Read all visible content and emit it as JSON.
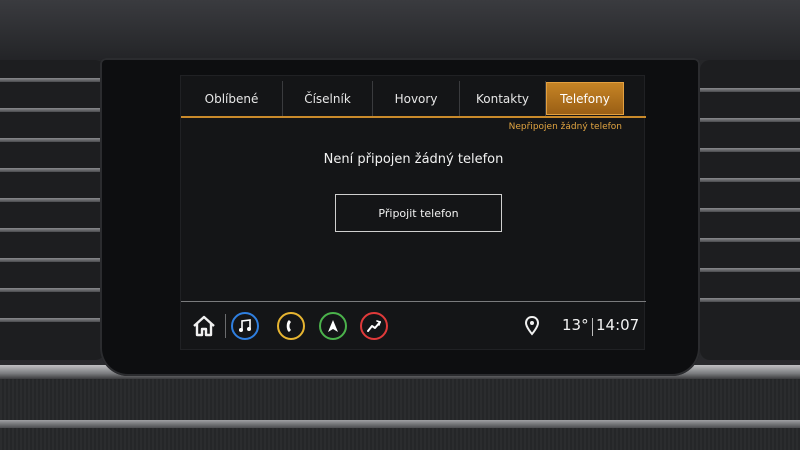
{
  "tabs": [
    {
      "label": "Oblíbené",
      "active": false
    },
    {
      "label": "Číselník",
      "active": false
    },
    {
      "label": "Hovory",
      "active": false
    },
    {
      "label": "Kontakty",
      "active": false
    },
    {
      "label": "Telefony",
      "active": true
    }
  ],
  "status": "Nepřipojen žádný telefon",
  "message": "Není připojen žádný telefon",
  "connect_button": "Připojit telefon",
  "bottom_bar": {
    "apps": [
      {
        "icon": "music-icon",
        "color": "#2f7fe0"
      },
      {
        "icon": "phone-icon",
        "color": "#e7b531"
      },
      {
        "icon": "navigation-icon",
        "color": "#4bb24b"
      },
      {
        "icon": "onstar-icon",
        "color": "#e03a3a"
      }
    ],
    "temperature": "13°",
    "time": "14:07"
  },
  "colors": {
    "accent": "#c98a2b",
    "status_text": "#e0a441"
  }
}
